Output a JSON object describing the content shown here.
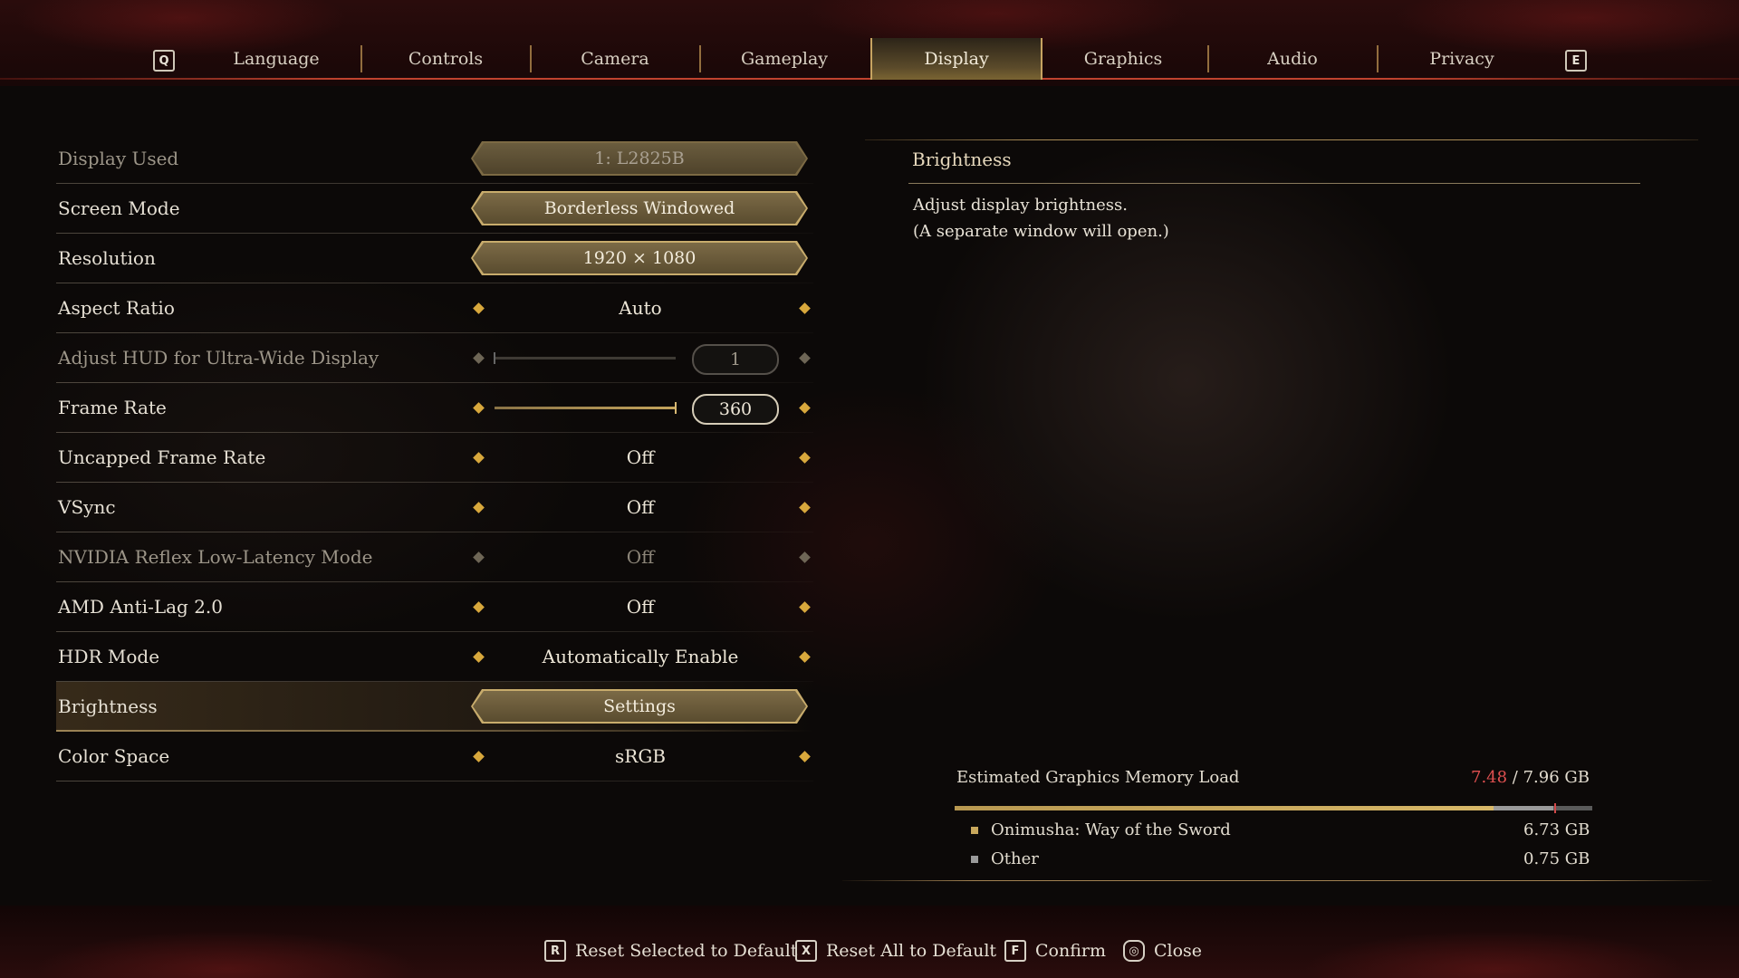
{
  "tabs": {
    "prev_key": "Q",
    "next_key": "E",
    "items": [
      {
        "label": "Language"
      },
      {
        "label": "Controls"
      },
      {
        "label": "Camera"
      },
      {
        "label": "Gameplay"
      },
      {
        "label": "Display"
      },
      {
        "label": "Graphics"
      },
      {
        "label": "Audio"
      },
      {
        "label": "Privacy"
      }
    ],
    "active": "Display"
  },
  "settings": [
    {
      "label": "Display Used",
      "type": "button",
      "value": "1: L2825B",
      "enabled": false
    },
    {
      "label": "Screen Mode",
      "type": "button",
      "value": "Borderless Windowed",
      "enabled": true
    },
    {
      "label": "Resolution",
      "type": "button",
      "value": "1920 × 1080",
      "enabled": true
    },
    {
      "label": "Aspect Ratio",
      "type": "selector",
      "value": "Auto",
      "enabled": true
    },
    {
      "label": "Adjust HUD for Ultra-Wide Display",
      "type": "slider",
      "value": "1",
      "fill": 0.0,
      "enabled": false
    },
    {
      "label": "Frame Rate",
      "type": "slider",
      "value": "360",
      "fill": 1.0,
      "enabled": true
    },
    {
      "label": "Uncapped Frame Rate",
      "type": "selector",
      "value": "Off",
      "enabled": true
    },
    {
      "label": "VSync",
      "type": "selector",
      "value": "Off",
      "enabled": true
    },
    {
      "label": "NVIDIA Reflex Low-Latency Mode",
      "type": "selector",
      "value": "Off",
      "enabled": false
    },
    {
      "label": "AMD Anti-Lag 2.0",
      "type": "selector",
      "value": "Off",
      "enabled": true
    },
    {
      "label": "HDR Mode",
      "type": "selector",
      "value": "Automatically Enable",
      "enabled": true
    },
    {
      "label": "Brightness",
      "type": "button",
      "value": "Settings",
      "enabled": true,
      "selected": true
    },
    {
      "label": "Color Space",
      "type": "selector",
      "value": "sRGB",
      "enabled": true
    }
  ],
  "info": {
    "title": "Brightness",
    "description_line1": "Adjust display brightness.",
    "description_line2": "(A separate window will open.)"
  },
  "memory": {
    "label": "Estimated Graphics Memory Load",
    "used": "7.48",
    "total": " / 7.96 GB",
    "game_fraction": 0.845,
    "other_fraction": 0.094,
    "items": [
      {
        "name": "Onimusha: Way of the Sword",
        "value": "6.73 GB",
        "color": "#c9a85c"
      },
      {
        "name": "Other",
        "value": "0.75 GB",
        "color": "#9a9a9a"
      }
    ]
  },
  "footer": [
    {
      "key": "R",
      "label": "Reset Selected to Default"
    },
    {
      "key": "X",
      "label": "Reset All to Default"
    },
    {
      "key": "F",
      "label": "Confirm"
    },
    {
      "key": "◎",
      "label": "Close"
    }
  ],
  "colors": {
    "accent_gold": "#d8a83c",
    "memory_used": "#e05050",
    "frame_red": "#c0432e"
  }
}
